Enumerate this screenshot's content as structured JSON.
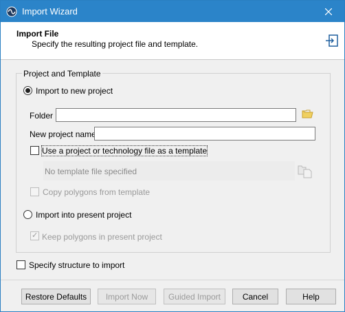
{
  "window": {
    "title": "Import Wizard"
  },
  "header": {
    "title": "Import File",
    "subtitle": "Specify the resulting project file and template."
  },
  "group": {
    "legend": "Project and Template"
  },
  "options": {
    "import_new": {
      "label": "Import to new project",
      "checked": true
    },
    "folder": {
      "label": "Folder",
      "value": ""
    },
    "new_project_name": {
      "label": "New project name",
      "value": ""
    },
    "use_template": {
      "label": "Use a project or technology file as a template",
      "checked": false
    },
    "template_file": {
      "placeholder": "No template file specified"
    },
    "copy_polygons": {
      "label": "Copy polygons from template",
      "checked": false,
      "enabled": false
    },
    "import_present": {
      "label": "Import into present project",
      "checked": false
    },
    "keep_polygons": {
      "label": "Keep polygons in present project",
      "checked": true,
      "enabled": false
    }
  },
  "specify_structure": {
    "label": "Specify structure to import",
    "checked": false
  },
  "buttons": {
    "restore": "Restore Defaults",
    "import_now": "Import Now",
    "guided_import": "Guided Import",
    "cancel": "Cancel",
    "help": "Help"
  },
  "colors": {
    "titlebar": "#2b84c9",
    "folder_icon": "#e8c34a"
  }
}
